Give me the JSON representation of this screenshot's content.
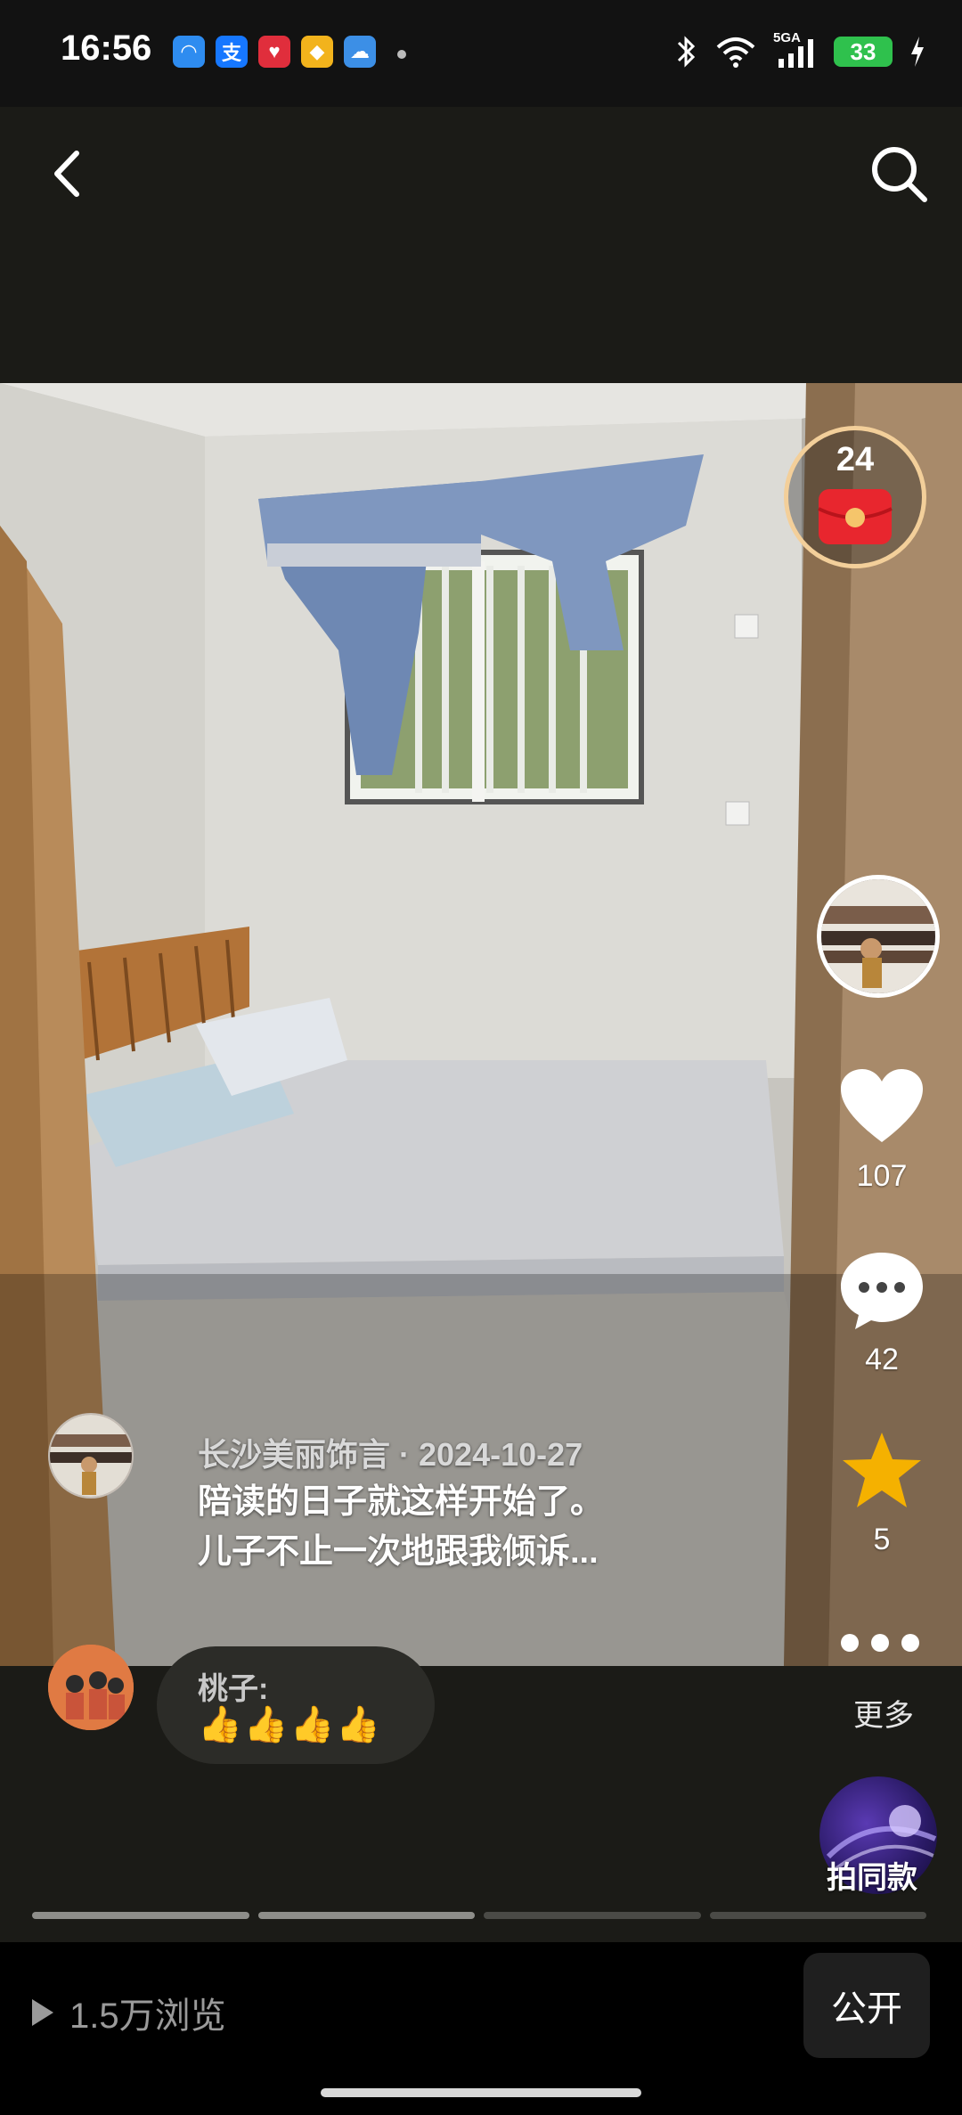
{
  "status_bar": {
    "time": "16:56",
    "apps": [
      {
        "name": "qq-browser-icon",
        "glyph": "◠",
        "color": "#2e8cf0"
      },
      {
        "name": "alipay-icon",
        "glyph": "支",
        "color": "#1677ff"
      },
      {
        "name": "health-app-icon",
        "glyph": "♥",
        "color": "#e02e3c"
      },
      {
        "name": "gold-app-icon",
        "glyph": "◆",
        "color": "#f2b31c"
      },
      {
        "name": "weather-icon",
        "glyph": "☁",
        "color": "#3c8fe6"
      }
    ],
    "network_label": "5GA",
    "battery_level": "33"
  },
  "post": {
    "red_packet_count": "24",
    "author": "长沙美丽饰言",
    "date": "2024-10-27",
    "meta_separator": " · ",
    "caption_line1": "陪读的日子就这样开始了。",
    "caption_line2": "儿子不止一次地跟我倾诉..."
  },
  "actions": {
    "likes": "107",
    "comments": "42",
    "favorites": "5"
  },
  "comment": {
    "name": "桃子:",
    "emojis": "👍👍👍👍"
  },
  "more_label": "更多",
  "template_label": "拍同款",
  "progress": {
    "segments": 4,
    "completed": 2
  },
  "bottom": {
    "views": "1.5万浏览",
    "public_label": "公开"
  },
  "colors": {
    "accent_red": "#e8262e",
    "star_yellow": "#f5b100",
    "battery_green": "#2fc14d"
  }
}
